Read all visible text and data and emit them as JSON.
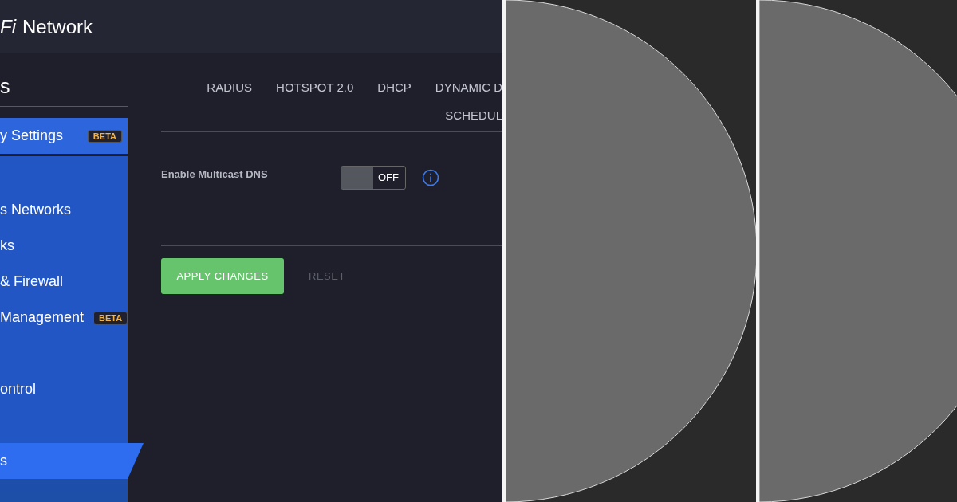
{
  "header": {
    "logo_text": "Fi",
    "title": "Network"
  },
  "sidebar": {
    "heading": "s",
    "items": [
      {
        "label": "y Settings",
        "badge": "BETA",
        "selected": false,
        "highlighted": true
      },
      {
        "selected": false,
        "highlighted": false
      },
      {
        "label": "s Networks",
        "selected": false,
        "highlighted": false
      },
      {
        "label": "ks",
        "selected": false,
        "highlighted": false
      },
      {
        "label": "& Firewall",
        "selected": false,
        "highlighted": false
      },
      {
        "label": "Management",
        "badge": "BETA",
        "selected": false,
        "highlighted": false
      },
      {
        "selected": false,
        "highlighted": false
      },
      {
        "label": "ontrol",
        "selected": false,
        "highlighted": false
      },
      {
        "selected": false,
        "highlighted": false
      },
      {
        "label": "s",
        "selected": true,
        "highlighted": false
      }
    ]
  },
  "tabs": [
    {
      "label": "RADIUS",
      "selected": false
    },
    {
      "label": "HOTSPOT 2.0",
      "selected": false
    },
    {
      "label": "DHCP",
      "selected": false
    },
    {
      "label": "DYNAMIC D",
      "selected": false
    },
    {
      "label": "SCHEDUL",
      "selected": false
    }
  ],
  "settings": [
    {
      "label": "Enable Multicast DNS",
      "on": false,
      "reading": "OFF"
    }
  ],
  "buttons": [
    {
      "label": "APPLY CHANGES",
      "kind": "primary"
    },
    {
      "label": "RESET",
      "kind": "plain"
    }
  ],
  "panels": [
    {
      "kind": "half-circle"
    },
    {
      "kind": "half-circle"
    }
  ]
}
